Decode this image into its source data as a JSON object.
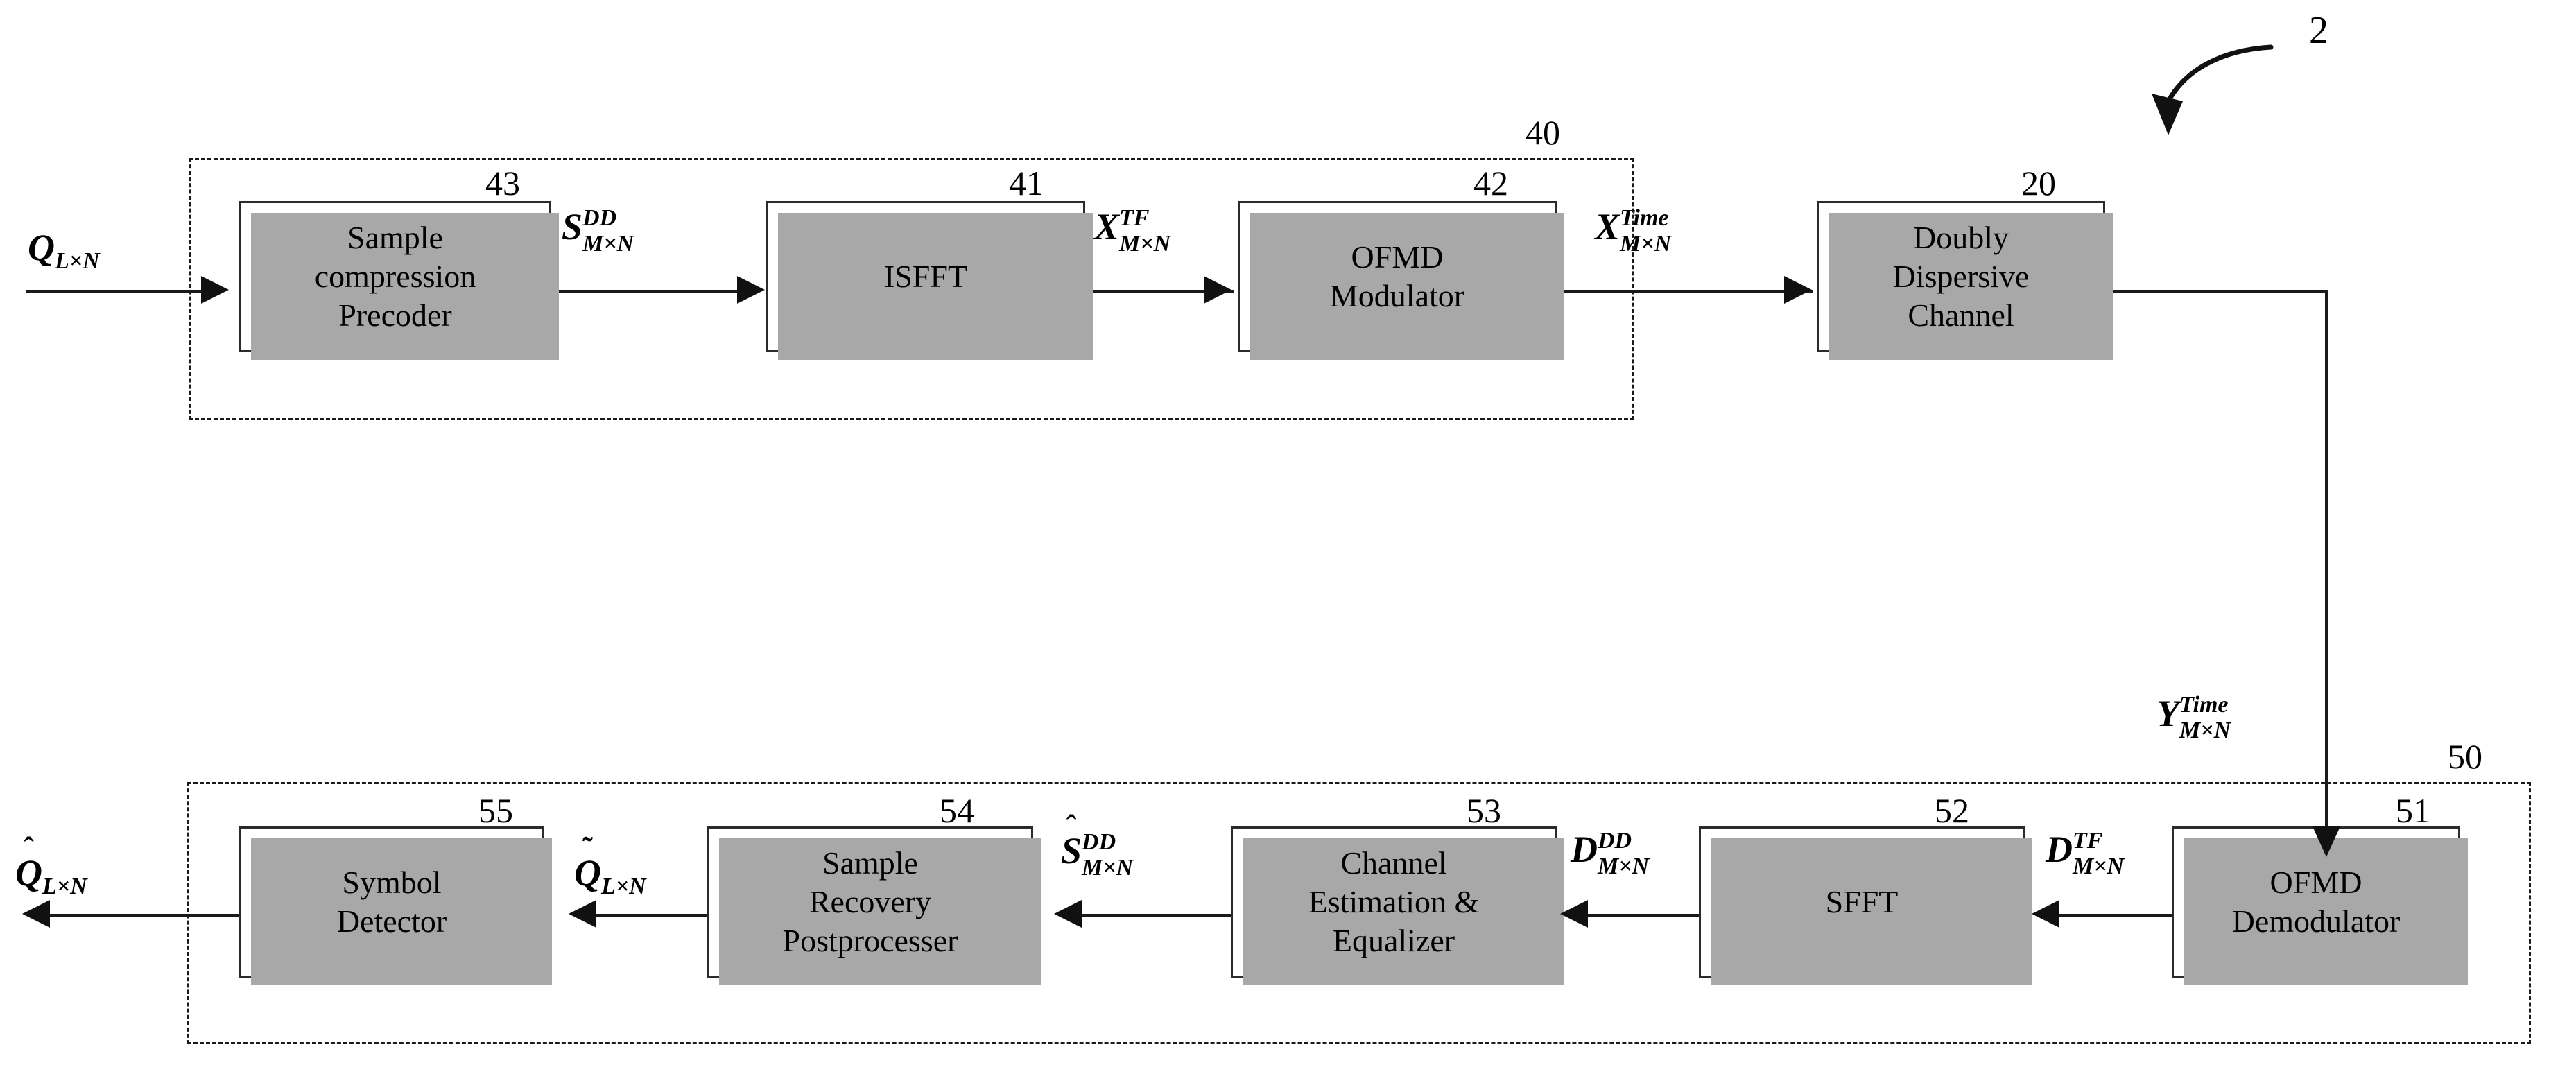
{
  "figure": {
    "callout": {
      "number": "2",
      "icon": "curved-arrow-icon"
    }
  },
  "groups": [
    {
      "id": "transmitter",
      "ref": "40"
    },
    {
      "id": "receiver",
      "ref": "50"
    }
  ],
  "blocks": [
    {
      "id": "sample-compression-precoder",
      "ref": "43",
      "label": "Sample\ncompression\nPrecoder"
    },
    {
      "id": "isfft",
      "ref": "41",
      "label": "ISFFT"
    },
    {
      "id": "ofmd-modulator",
      "ref": "42",
      "label": "OFMD\nModulator"
    },
    {
      "id": "doubly-dispersive-channel",
      "ref": "20",
      "label": "Doubly\nDispersive\nChannel"
    },
    {
      "id": "ofmd-demodulator",
      "ref": "51",
      "label": "OFMD\nDemodulator"
    },
    {
      "id": "sfft",
      "ref": "52",
      "label": "SFFT"
    },
    {
      "id": "channel-estimation-equalizer",
      "ref": "53",
      "label": "Channel\nEstimation &\nEqualizer"
    },
    {
      "id": "sample-recovery-postprocesser",
      "ref": "54",
      "label": "Sample\nRecovery\nPostprocesser"
    },
    {
      "id": "symbol-detector",
      "ref": "55",
      "label": "Symbol\nDetector"
    }
  ],
  "signals": [
    {
      "id": "q-in",
      "accent": "",
      "base": "Q",
      "sup": "",
      "sub": "L×N"
    },
    {
      "id": "s-dd",
      "accent": "",
      "base": "S",
      "sup": "DD",
      "sub": "M×N"
    },
    {
      "id": "x-tf",
      "accent": "",
      "base": "X",
      "sup": "TF",
      "sub": "M×N"
    },
    {
      "id": "x-time",
      "accent": "",
      "base": "X",
      "sup": "Time",
      "sub": "M×N"
    },
    {
      "id": "y-time",
      "accent": "",
      "base": "Y",
      "sup": "Time",
      "sub": "M×N"
    },
    {
      "id": "d-tf",
      "accent": "",
      "base": "D",
      "sup": "TF",
      "sub": "M×N"
    },
    {
      "id": "d-dd",
      "accent": "",
      "base": "D",
      "sup": "DD",
      "sub": "M×N"
    },
    {
      "id": "s-hat-dd",
      "accent": "ˆ",
      "base": "S",
      "sup": "DD",
      "sub": "M×N"
    },
    {
      "id": "q-tilde-out",
      "accent": "˜",
      "base": "Q",
      "sup": "",
      "sub": "L×N"
    },
    {
      "id": "q-hat-out",
      "accent": "ˆ",
      "base": "Q",
      "sup": "",
      "sub": "L×N"
    }
  ],
  "colors": {
    "stroke": "#1a1a1a",
    "shadow": "#a8a8a8",
    "background": "#ffffff"
  }
}
